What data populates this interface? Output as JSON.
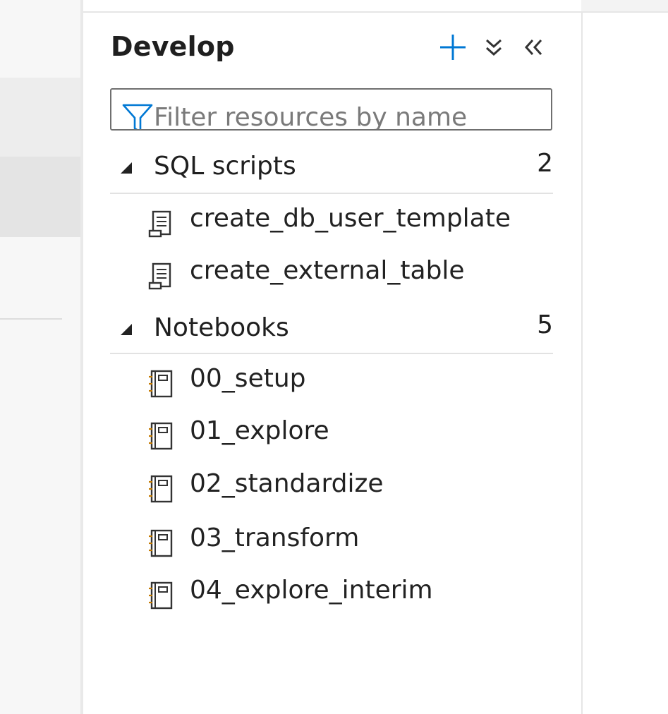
{
  "panel": {
    "title": "Develop",
    "toolbar": {
      "add": "add-icon",
      "expand_all": "chevron-double-down-icon",
      "collapse_panel": "chevron-double-left-icon"
    },
    "filter": {
      "placeholder": "Filter resources by name",
      "value": ""
    }
  },
  "sections": [
    {
      "label": "SQL scripts",
      "count": "2",
      "items": [
        {
          "label": "create_db_user_template",
          "icon": "sql-script-icon"
        },
        {
          "label": "create_external_table",
          "icon": "sql-script-icon"
        }
      ]
    },
    {
      "label": "Notebooks",
      "count": "5",
      "items": [
        {
          "label": "00_setup",
          "icon": "notebook-icon"
        },
        {
          "label": "01_explore",
          "icon": "notebook-icon"
        },
        {
          "label": "02_standardize",
          "icon": "notebook-icon"
        },
        {
          "label": "03_transform",
          "icon": "notebook-icon"
        },
        {
          "label": "04_explore_interim",
          "icon": "notebook-icon"
        }
      ]
    }
  ],
  "colors": {
    "accent": "#0078d4",
    "text": "#1f1f1f",
    "border": "#6f6f6f"
  }
}
